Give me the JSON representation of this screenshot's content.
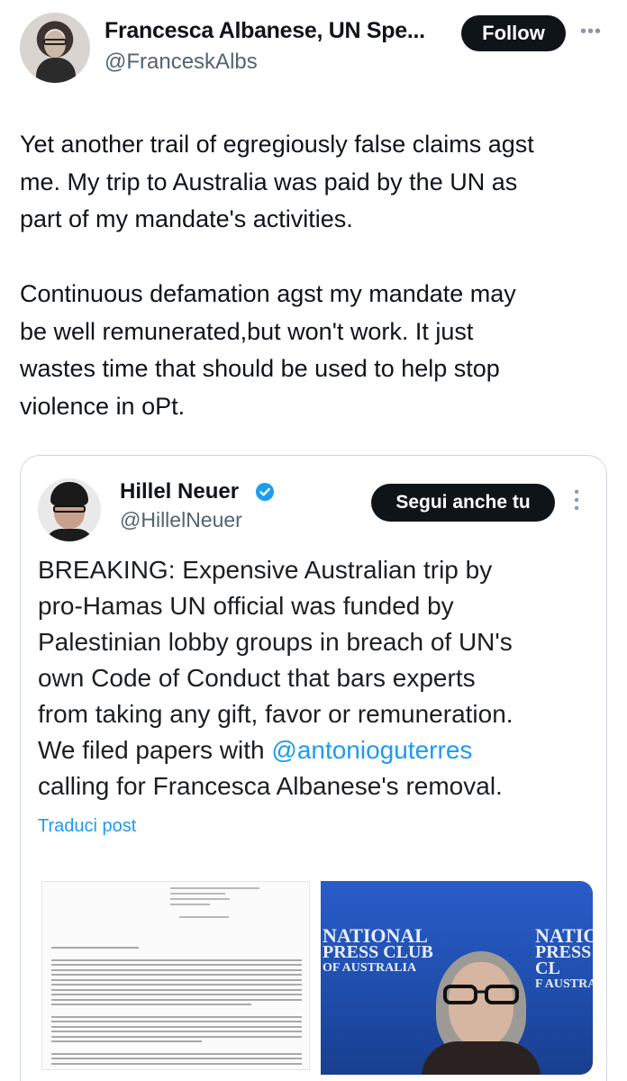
{
  "author": {
    "name": "Francesca Albanese, UN Spe...",
    "handle": "@FranceskAlbs",
    "follow_label": "Follow"
  },
  "tweet": {
    "text": "Yet another trail of egregiously false claims agst\nme. My trip to Australia was paid by the UN as\npart of my mandate's activities.\n\nContinuous defamation agst my mandate may\nbe well remunerated,but won't work. It just\nwastes time that should be used to help stop\nviolence in oPt."
  },
  "quoted": {
    "name": "Hillel Neuer",
    "handle": "@HillelNeuer",
    "follow_label": "Segui anche tu",
    "text_before": "BREAKING: Expensive Australian trip by\npro-Hamas UN official was funded by\nPalestinian lobby groups in breach of UN's\nown Code of Conduct that bars experts\nfrom taking any gift, favor or remuneration.\nWe filed papers with ",
    "mention": "@antonioguterres",
    "text_after": "\ncalling for Francesca Albanese's removal.",
    "translate_label": "Traduci post",
    "photo_sign": {
      "line1": "NATIONAL",
      "line2": "PRESS CLUB",
      "line3": "OF AUSTRALIA"
    },
    "photo_sign_cropped": {
      "line1": "NATION",
      "line2": "PRESS CL",
      "line3": "F AUSTRA"
    }
  },
  "icons": {
    "more": "more-horizontal-icon",
    "verified": "verified-badge-icon",
    "quote_more": "more-vertical-icon"
  },
  "colors": {
    "accent": "#1d9bf0",
    "button": "#0f1419",
    "secondary_text": "#536471"
  }
}
